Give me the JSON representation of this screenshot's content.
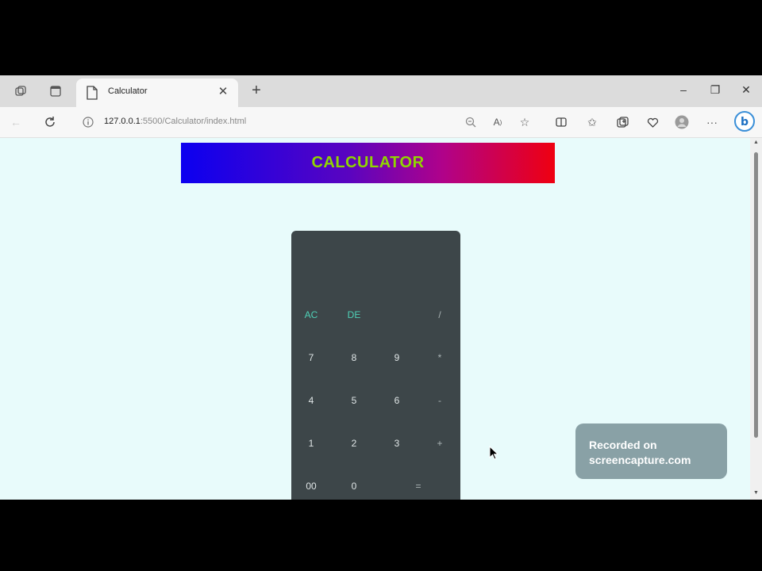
{
  "browser": {
    "tab": {
      "title": "Calculator",
      "close": "✕"
    },
    "new_tab": "+",
    "window_controls": {
      "minimize": "–",
      "restore": "❐",
      "close": "✕"
    },
    "address": {
      "host": "127.0.0.1",
      "path": ":5500/Calculator/index.html"
    },
    "toolbar_icons": [
      "zoom-icon",
      "read-aloud-icon",
      "favorite-star-icon",
      "split-screen-icon",
      "favorites-icon",
      "collections-icon",
      "heart-icon",
      "profile-icon",
      "more-icon",
      "bing-icon"
    ]
  },
  "page": {
    "header_title": "CALCULATOR",
    "header_colors": [
      "#0b00f0",
      "#ef0010"
    ],
    "title_color": "#8fd600",
    "calculator": {
      "display_value": "",
      "rows": [
        [
          "AC",
          "DE",
          "",
          "/"
        ],
        [
          "7",
          "8",
          "9",
          "*"
        ],
        [
          "4",
          "5",
          "6",
          "-"
        ],
        [
          "1",
          "2",
          "3",
          "+"
        ],
        [
          "00",
          "0",
          "="
        ]
      ]
    }
  },
  "watermark": {
    "line1": "Recorded on",
    "line2": "screencapture.com"
  }
}
